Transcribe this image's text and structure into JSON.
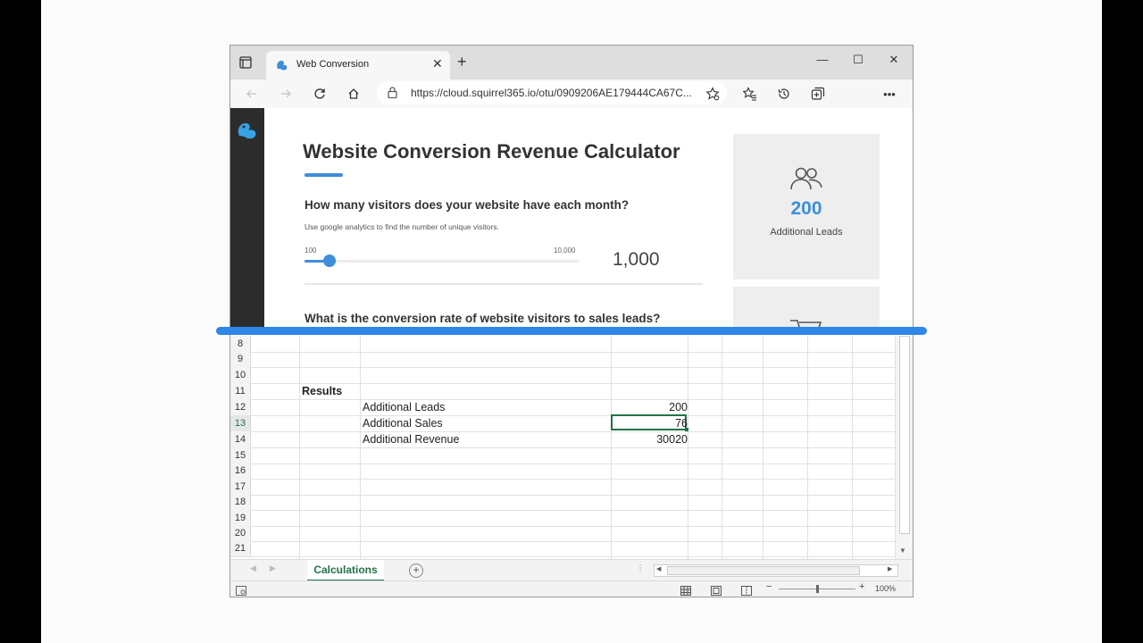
{
  "browser": {
    "tab_title": "Web Conversion",
    "address": "https://cloud.squirrel365.io/otu/0909206AE179444CA67C..."
  },
  "page": {
    "title": "Website Conversion Revenue Calculator",
    "question1": "How many visitors does your website have each month?",
    "question1_hint": "Use google analytics to find the number of unique visitors.",
    "slider_min": "100",
    "slider_max": "10,000",
    "slider_fraction": 0.09,
    "visitors_value": "1,000",
    "question2": "What is the conversion rate of website visitors to sales leads?",
    "card_value": "200",
    "card_label": "Additional Leads",
    "accent_color": "#3d8edb"
  },
  "sheet": {
    "row_numbers": [
      "8",
      "9",
      "10",
      "11",
      "12",
      "13",
      "14",
      "15",
      "16",
      "17",
      "18",
      "19",
      "20",
      "21"
    ],
    "results_header": "Results",
    "rows": [
      {
        "label": "Additional Leads",
        "value": "200"
      },
      {
        "label": "Additional Sales",
        "value": "76"
      },
      {
        "label": "Additional Revenue",
        "value": "30020"
      }
    ],
    "tab_name": "Calculations",
    "add_sheet": "+",
    "zoom": "100%"
  }
}
